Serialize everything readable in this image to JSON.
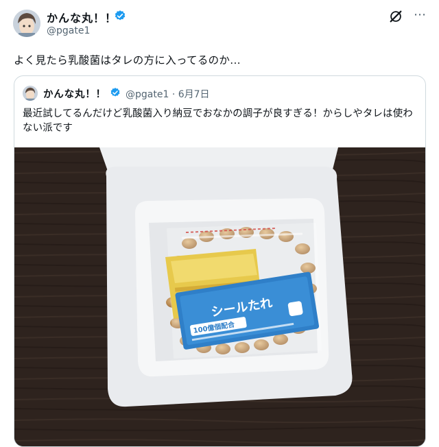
{
  "post": {
    "author": {
      "display_name": "かんな丸！！",
      "handle": "@pgate1"
    },
    "text": "よく見たら乳酸菌はタレの方に入ってるのか..."
  },
  "quoted_post": {
    "author": {
      "display_name": "かんな丸！！",
      "handle": "@pgate1"
    },
    "date": "6月7日",
    "meta": "@pgate1 · 6月7日",
    "text": "最近試してるんだけど乳酸菌入り納豆でおなかの調子が良すぎる！からしやタレは使わない派です"
  },
  "media": {
    "packet_text": "シールたれ",
    "packet_badge": "100億個配合"
  },
  "colors": {
    "verified": "#1d9bf0",
    "text": "#0f1419",
    "secondary": "#536471",
    "border": "#cfd9de"
  },
  "icons": [
    "verified-badge-icon",
    "grok-icon",
    "more-options-icon"
  ]
}
